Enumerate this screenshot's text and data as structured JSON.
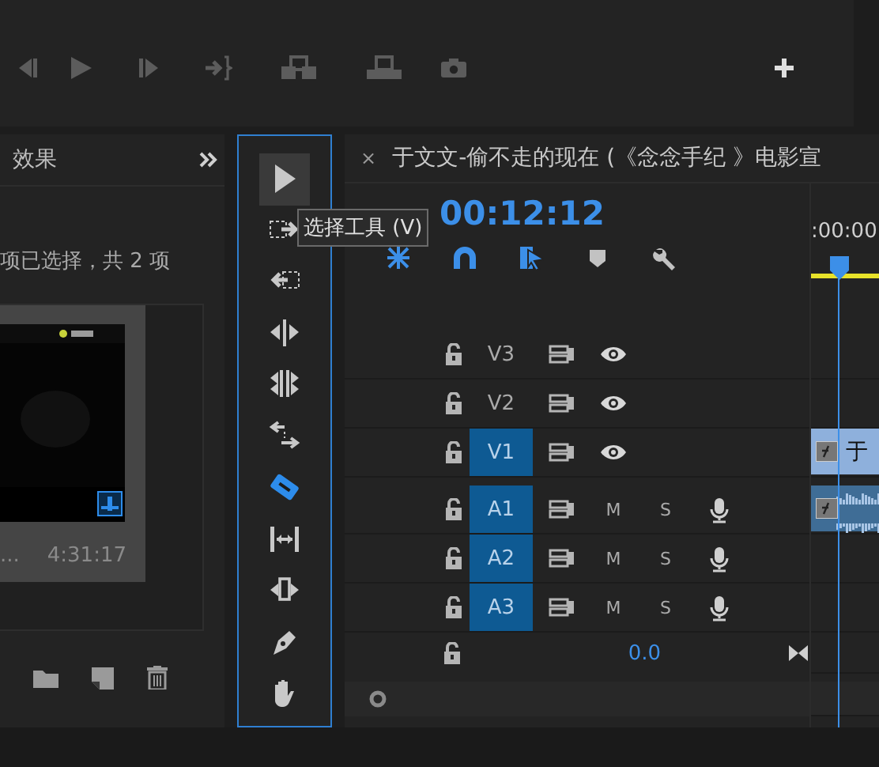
{
  "project_panel": {
    "tab": "效果",
    "selection_info": "项已选择，共 2 项",
    "clip": {
      "kind": "picture",
      "name": "...",
      "duration": "4:31:17"
    }
  },
  "tools": [
    {
      "kind": "selection",
      "selected": false,
      "highlighted": true
    },
    {
      "kind": "track-forward",
      "selected": false,
      "highlighted": false
    },
    {
      "kind": "track-backward",
      "selected": false,
      "highlighted": false
    },
    {
      "kind": "ripple",
      "selected": false,
      "highlighted": false
    },
    {
      "kind": "rolling",
      "selected": false,
      "highlighted": false
    },
    {
      "kind": "rate",
      "selected": false,
      "highlighted": false
    },
    {
      "kind": "razor",
      "selected": true,
      "highlighted": false
    },
    {
      "kind": "slip",
      "selected": false,
      "highlighted": false
    },
    {
      "kind": "slide",
      "selected": false,
      "highlighted": false
    },
    {
      "kind": "pen",
      "selected": false,
      "highlighted": false
    },
    {
      "kind": "hand",
      "selected": false,
      "highlighted": false
    }
  ],
  "tooltip": "选择工具 (V)",
  "timeline": {
    "close": "×",
    "title": "于文文-偷不走的现在 (《念念手纪 》电影宣",
    "timecode": "00:12:12",
    "ruler_label": ":00:00",
    "controls": [
      {
        "kind": "nest",
        "on": true
      },
      {
        "kind": "snap",
        "on": true
      },
      {
        "kind": "linked",
        "on": true
      },
      {
        "kind": "marker",
        "on": false
      },
      {
        "kind": "settings",
        "on": false
      }
    ],
    "tracks": [
      {
        "kind": "video",
        "label": "V3",
        "targeted": false
      },
      {
        "kind": "video",
        "label": "V2",
        "targeted": false
      },
      {
        "kind": "video",
        "label": "V1",
        "targeted": true
      },
      {
        "kind": "audio",
        "label": "A1",
        "targeted": true,
        "mute": "M",
        "solo": "S"
      },
      {
        "kind": "audio",
        "label": "A2",
        "targeted": true,
        "mute": "M",
        "solo": "S"
      },
      {
        "kind": "audio",
        "label": "A3",
        "targeted": true,
        "mute": "M",
        "solo": "S"
      }
    ],
    "master": {
      "value": "0.0"
    },
    "clips": [
      {
        "kind": "video",
        "title": "于"
      },
      {
        "kind": "audio"
      }
    ]
  }
}
